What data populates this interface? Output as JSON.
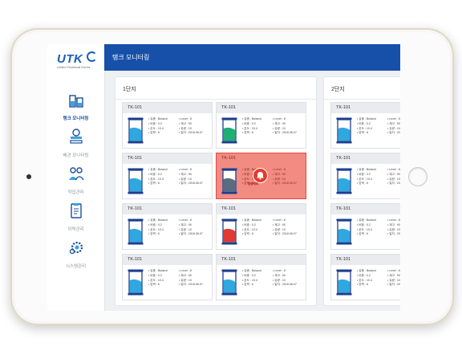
{
  "app": {
    "logo": "UTK",
    "logo_sub": "United Technical Korea"
  },
  "header": {
    "title": "탱크 모니터링"
  },
  "sidebar": {
    "items": [
      {
        "label": "탱크 모니터링",
        "icon": "tank-monitoring-icon",
        "active": true
      },
      {
        "label": "배관 모니터링",
        "icon": "pipe-monitoring-icon",
        "active": false
      },
      {
        "label": "작업관리",
        "icon": "work-management-icon",
        "active": false
      },
      {
        "label": "이력관리",
        "icon": "history-management-icon",
        "active": false
      },
      {
        "label": "시스템관리",
        "icon": "system-management-icon",
        "active": false
      }
    ]
  },
  "panels": [
    {
      "title": "1단지"
    },
    {
      "title": "2단지"
    }
  ],
  "card": {
    "name": "TK-101",
    "fluid": "• 유종 : Butanol",
    "ratio": "• 비중 : 0.2",
    "temp": "• 온도 : 10.4",
    "pressure": "• 압력 : 6",
    "level": "• Level : 8",
    "stock": "• 재고 : 90",
    "flow": "• 유량 : 10",
    "date": "• 일자 : 2018.06.07"
  },
  "alarm": {
    "label": "알람해제"
  },
  "colors": {
    "header": "#1750a8",
    "tank_frame": "#1c3f8e",
    "fill_blue": "#2fa8e0",
    "fill_green": "#1fae73",
    "fill_red": "#e03a32",
    "fill_gray": "#5a6b82",
    "alarm_bg": "#f28b82"
  }
}
